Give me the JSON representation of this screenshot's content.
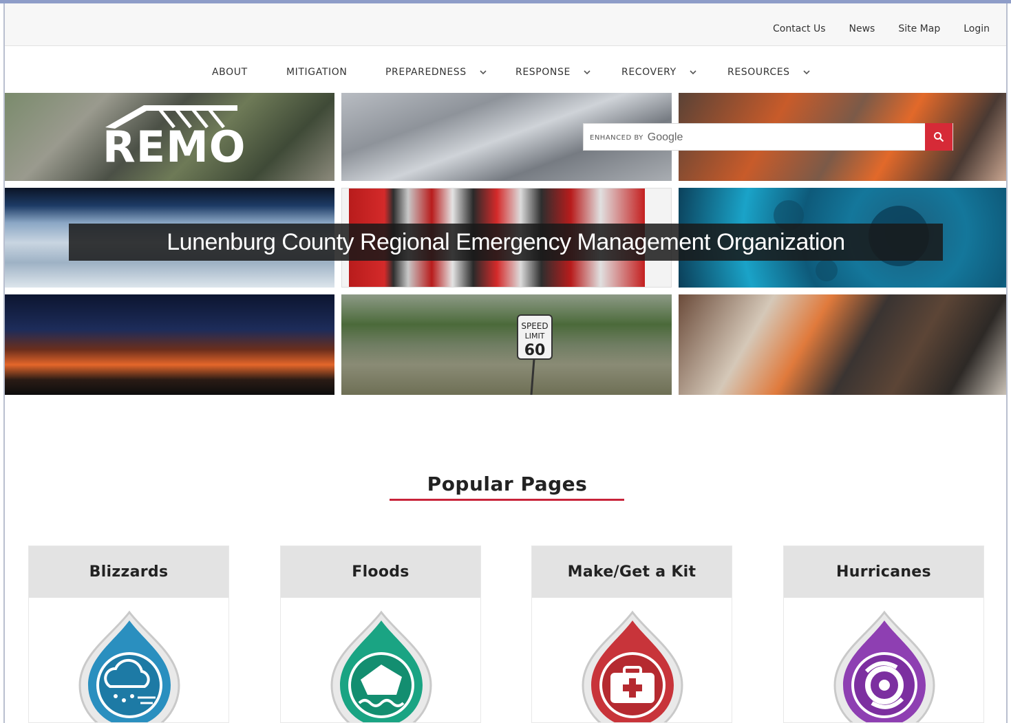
{
  "utility_links": [
    "Contact Us",
    "News",
    "Site Map",
    "Login"
  ],
  "nav": [
    {
      "label": "ABOUT",
      "dropdown": false
    },
    {
      "label": "MITIGATION",
      "dropdown": false
    },
    {
      "label": "PREPAREDNESS",
      "dropdown": true
    },
    {
      "label": "RESPONSE",
      "dropdown": true
    },
    {
      "label": "RECOVERY",
      "dropdown": true
    },
    {
      "label": "RESOURCES",
      "dropdown": true
    }
  ],
  "hero": {
    "logo_text": "REMO",
    "banner": "Lunenburg County Regional Emergency Management Organization",
    "search": {
      "enhanced_by": "ENHANCED BY",
      "brand": "Google",
      "value": "",
      "button_icon": "search-icon",
      "button_color": "#d62a37"
    },
    "speed_sign": {
      "line1": "SPEED",
      "line2": "LIMIT",
      "value": "60"
    }
  },
  "popular": {
    "title": "Popular Pages",
    "accent": "#c8233a",
    "cards": [
      {
        "label": "Blizzards",
        "icon": "snow-cloud-icon",
        "color": "#2a8fbf"
      },
      {
        "label": "Floods",
        "icon": "flooded-house-icon",
        "color": "#1aa483"
      },
      {
        "label": "Make/Get a Kit",
        "icon": "first-aid-kit-icon",
        "color": "#c8343a"
      },
      {
        "label": "Hurricanes",
        "icon": "hurricane-icon",
        "color": "#8e3fb2"
      }
    ]
  }
}
